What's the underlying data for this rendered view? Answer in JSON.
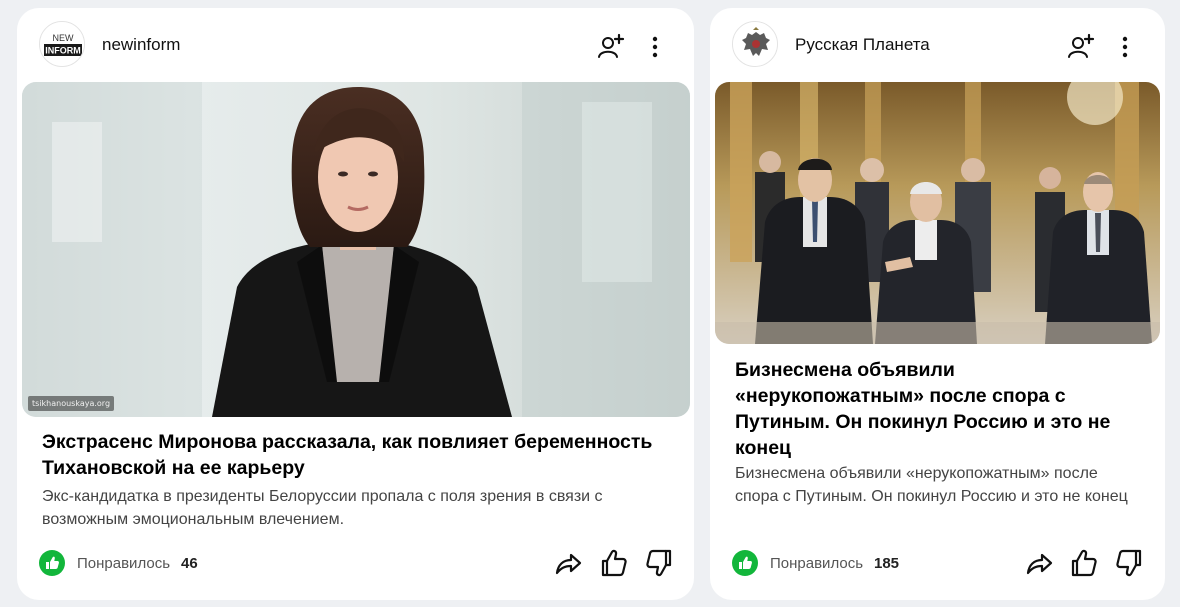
{
  "feed": {
    "cards": [
      {
        "source": {
          "name": "newinform",
          "avatar_text_top": "NEW",
          "avatar_text_bottom": "INFORM"
        },
        "image": {
          "caption": "tsikhanouskaya.org",
          "icon": "portrait-photo"
        },
        "title": "Экстрасенс Миронова рассказала, как повлияет беременность Тихановской на ее карьеру",
        "snippet": "Экс-кандидатка в президенты Белоруссии пропала с поля зрения в связи с возможным эмоциональным влечением.",
        "likes": {
          "label": "Понравилось",
          "count": "46"
        }
      },
      {
        "source": {
          "name": "Русская Планета",
          "avatar_icon": "eagle-emblem-icon"
        },
        "image": {
          "icon": "group-photo"
        },
        "title": "Бизнесмена объявили «нерукопожатным» после спора с Путиным. Он покинул Россию и это не конец",
        "snippet": "Бизнесмена объявили «нерукопожатным» после спора с Путиным. Он покинул Россию и это не конец",
        "likes": {
          "label": "Понравилось",
          "count": "185"
        }
      }
    ]
  },
  "colors": {
    "like_green": "#12b63b",
    "background": "#eef0f3",
    "card": "#ffffff"
  }
}
